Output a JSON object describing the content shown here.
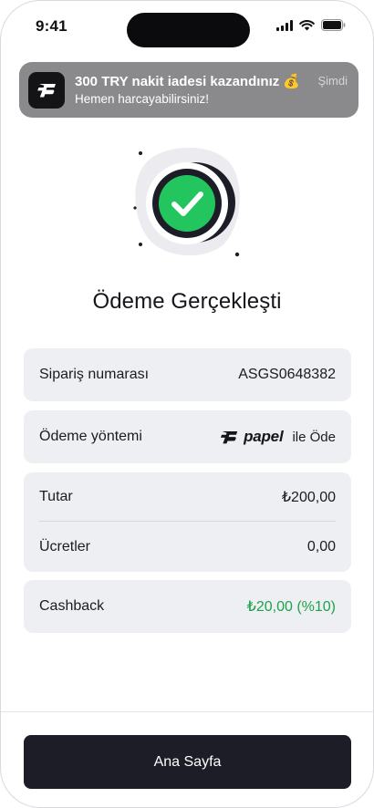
{
  "status_bar": {
    "time": "9:41"
  },
  "notification": {
    "title": "300 TRY nakit iadesi kazandınız 💰",
    "body": "Hemen harcayabilirsiniz!",
    "time": "Şimdi"
  },
  "page": {
    "title": "Ödeme Gerçekleşti"
  },
  "order": {
    "label": "Sipariş numarası",
    "value": "ASGS0648382"
  },
  "payment_method": {
    "label": "Ödeme yöntemi",
    "brand": "papel",
    "suffix": "ile Öde"
  },
  "amounts": {
    "total_label": "Tutar",
    "total_value": "₺200,00",
    "fees_label": "Ücretler",
    "fees_value": "0,00"
  },
  "cashback": {
    "label": "Cashback",
    "value": "₺20,00 (%10)"
  },
  "actions": {
    "home_label": "Ana Sayfa"
  },
  "colors": {
    "success": "#1aa34a",
    "success_icon": "#22c55e",
    "dark": "#1c1d26",
    "card_bg": "#eeeff2"
  }
}
